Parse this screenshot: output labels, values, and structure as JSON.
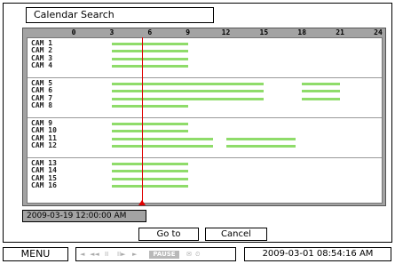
{
  "title": "Calendar Search",
  "hours": [
    "0",
    "3",
    "6",
    "9",
    "12",
    "15",
    "18",
    "21",
    "24"
  ],
  "cameras": [
    {
      "label": "CAM  1",
      "segments": [
        [
          3,
          9
        ]
      ]
    },
    {
      "label": "CAM  2",
      "segments": [
        [
          3,
          9
        ]
      ]
    },
    {
      "label": "CAM  3",
      "segments": [
        [
          3,
          9
        ]
      ]
    },
    {
      "label": "CAM  4",
      "segments": [
        [
          3,
          9
        ]
      ]
    },
    {
      "label": "CAM  5",
      "segments": [
        [
          3,
          15
        ],
        [
          18,
          21
        ]
      ]
    },
    {
      "label": "CAM  6",
      "segments": [
        [
          3,
          15
        ],
        [
          18,
          21
        ]
      ]
    },
    {
      "label": "CAM  7",
      "segments": [
        [
          3,
          15
        ],
        [
          18,
          21
        ]
      ]
    },
    {
      "label": "CAM  8",
      "segments": [
        [
          3,
          9
        ]
      ]
    },
    {
      "label": "CAM  9",
      "segments": [
        [
          3,
          9
        ]
      ]
    },
    {
      "label": "CAM 10",
      "segments": [
        [
          3,
          9
        ]
      ]
    },
    {
      "label": "CAM 11",
      "segments": [
        [
          3,
          11
        ],
        [
          12,
          17.5
        ]
      ]
    },
    {
      "label": "CAM 12",
      "segments": [
        [
          3,
          11
        ],
        [
          12,
          17.5
        ]
      ]
    },
    {
      "label": "CAM 13",
      "segments": [
        [
          3,
          9
        ]
      ]
    },
    {
      "label": "CAM 14",
      "segments": [
        [
          3,
          9
        ]
      ]
    },
    {
      "label": "CAM 15",
      "segments": [
        [
          3,
          9
        ]
      ]
    },
    {
      "label": "CAM 16",
      "segments": [
        [
          3,
          9
        ]
      ]
    }
  ],
  "cursor_hour": 5.4,
  "selected_time": "2009-03-19 12:00:00 AM",
  "buttons": {
    "goto": "Go to",
    "cancel": "Cancel"
  },
  "bottom": {
    "menu": "MENU",
    "controls": [
      "◄",
      "◄◄",
      "II",
      "II►",
      "►"
    ],
    "pause": "PAUSE",
    "status_icons": [
      "✉",
      "⏲"
    ],
    "datetime": "2009-03-01 08:54:16 AM"
  },
  "colors": {
    "bar": "#8fdc6a",
    "cursor": "#e00000",
    "panel": "#a3a3a3"
  }
}
